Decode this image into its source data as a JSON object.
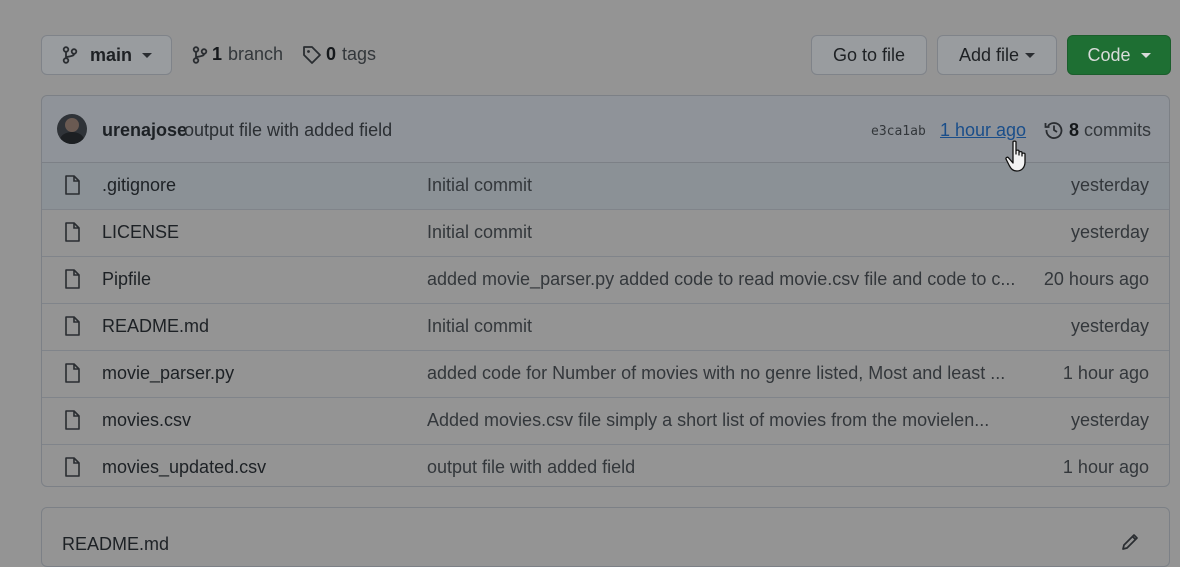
{
  "toolbar": {
    "branch_button": "main",
    "branches_count": "1",
    "branches_label": "branch",
    "tags_count": "0",
    "tags_label": "tags",
    "go_to_file": "Go to file",
    "add_file": "Add file",
    "code": "Code"
  },
  "latest_commit": {
    "author": "urenajose",
    "message": "output file with added field",
    "hash": "e3ca1ab",
    "time": "1 hour ago",
    "commits_count": "8",
    "commits_label": "commits"
  },
  "files": [
    {
      "name": ".gitignore",
      "message": "Initial commit",
      "age": "yesterday"
    },
    {
      "name": "LICENSE",
      "message": "Initial commit",
      "age": "yesterday"
    },
    {
      "name": "Pipfile",
      "message": "added movie_parser.py added code to read movie.csv file and code to c...",
      "age": "20 hours ago"
    },
    {
      "name": "README.md",
      "message": "Initial commit",
      "age": "yesterday"
    },
    {
      "name": "movie_parser.py",
      "message": "added code for Number of movies with no genre listed, Most and least ...",
      "age": "1 hour ago"
    },
    {
      "name": "movies.csv",
      "message": "Added movies.csv file simply a short list of movies from the movielen...",
      "age": "yesterday"
    },
    {
      "name": "movies_updated.csv",
      "message": "output file with added field",
      "age": "1 hour ago"
    }
  ],
  "readme": {
    "title": "README.md"
  },
  "colors": {
    "code_button": "#1e6f33",
    "overlay_bg": "#949494"
  },
  "icons": [
    "branch-icon",
    "tag-icon",
    "history-icon",
    "file-icon",
    "pencil-icon",
    "pointer-cursor-icon"
  ]
}
